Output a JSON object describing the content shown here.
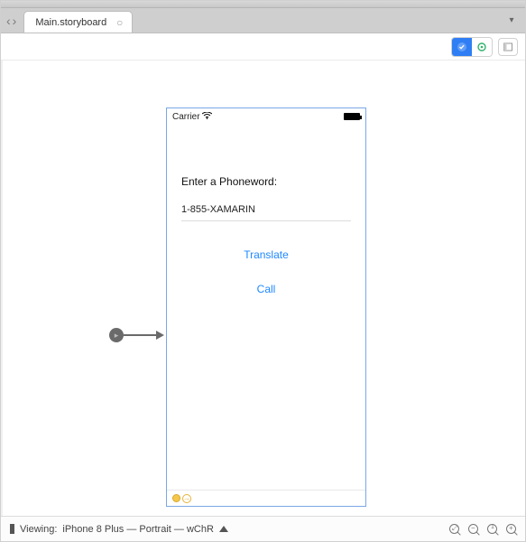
{
  "tab": {
    "title": "Main.storyboard",
    "close": "○"
  },
  "nav": {
    "back": "‹",
    "forward": "›",
    "dropdown": "▾"
  },
  "toolbar": {
    "mode_a_icon": "check-circle-icon",
    "mode_b_icon": "target-icon",
    "panel_icon": "panel-icon"
  },
  "entry_point": {
    "label": "▸"
  },
  "device": {
    "carrier": "Carrier",
    "wifi": "wifi-icon",
    "label": "Enter a Phoneword:",
    "textfield_value": "1-855-XAMARIN",
    "translate_btn": "Translate",
    "call_btn": "Call"
  },
  "statusbar": {
    "viewing_prefix": "Viewing:",
    "viewing_text": "iPhone 8 Plus — Portrait — wChR"
  }
}
